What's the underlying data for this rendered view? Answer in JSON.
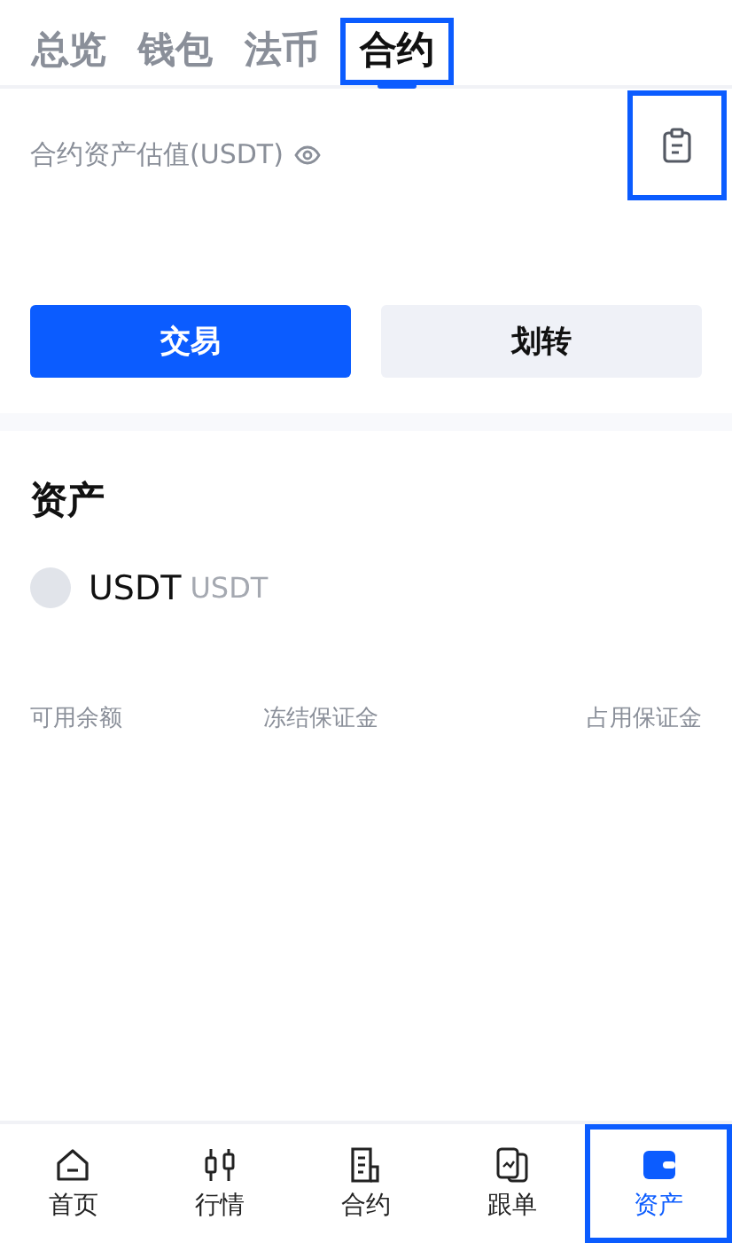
{
  "tabs": [
    {
      "label": "总览",
      "selected": false,
      "highlighted": false
    },
    {
      "label": "钱包",
      "selected": false,
      "highlighted": false
    },
    {
      "label": "法币",
      "selected": false,
      "highlighted": false
    },
    {
      "label": "合约",
      "selected": true,
      "highlighted": true
    }
  ],
  "valuation": {
    "label": "合约资产估值(USDT)",
    "record_icon_highlighted": true
  },
  "actions": [
    {
      "label": "交易",
      "kind": "primary"
    },
    {
      "label": "划转",
      "kind": "secondary"
    }
  ],
  "assets": {
    "title": "资产",
    "items": [
      {
        "symbol": "USDT",
        "name": "USDT",
        "columns": [
          "可用余额",
          "冻结保证金",
          "占用保证金"
        ]
      }
    ]
  },
  "bottom_nav": [
    {
      "label": "首页",
      "kind": "home",
      "selected": false,
      "highlighted": false
    },
    {
      "label": "行情",
      "kind": "candles",
      "selected": false,
      "highlighted": false
    },
    {
      "label": "合约",
      "kind": "document",
      "selected": false,
      "highlighted": false
    },
    {
      "label": "跟单",
      "kind": "cards",
      "selected": false,
      "highlighted": false
    },
    {
      "label": "资产",
      "kind": "wallet",
      "selected": true,
      "highlighted": true
    }
  ]
}
